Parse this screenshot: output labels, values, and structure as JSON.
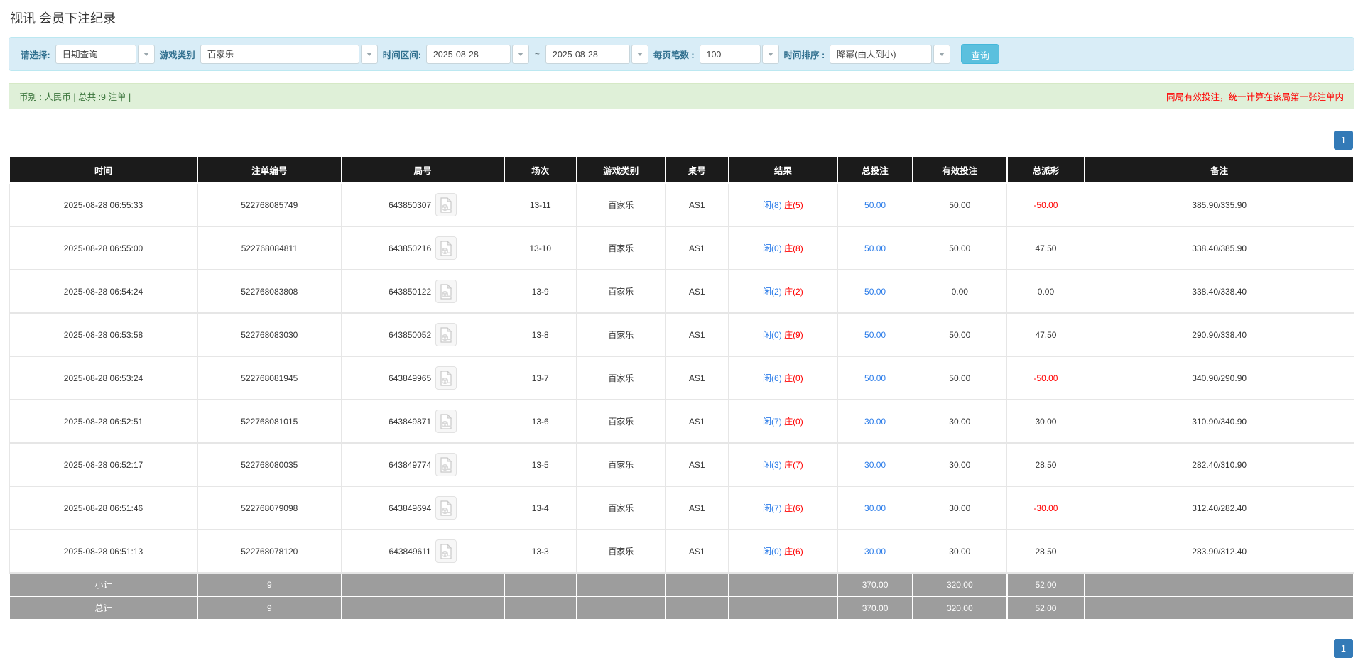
{
  "page": {
    "title": "视讯 会员下注纪录"
  },
  "filter_bar": {
    "select_label": "请选择:",
    "select_value": "日期查询",
    "game_type_label": "游戏类别",
    "game_type_value": "百家乐",
    "date_range_label": "时间区间:",
    "date_from": "2025-08-28",
    "range_separator": "~",
    "date_to": "2025-08-28",
    "page_size_label": "每页笔数 :",
    "page_size_value": "100",
    "sort_label": "时间排序 :",
    "sort_value": "降幂(由大到小)",
    "search_button": "查询"
  },
  "summary_bar": {
    "left_text": "币别 : 人民币 | 总共 :9 注单 |",
    "right_note": "同局有效投注，统一计算在该局第一张注单内"
  },
  "pagination": {
    "page": "1"
  },
  "table": {
    "headers": [
      "时间",
      "注单编号",
      "局号",
      "场次",
      "游戏类别",
      "桌号",
      "结果",
      "总投注",
      "有效投注",
      "总派彩",
      "备注"
    ],
    "rows": [
      {
        "time": "2025-08-28 06:55:33",
        "bet_id": "522768085749",
        "round_id": "643850307",
        "session": "13-11",
        "game": "百家乐",
        "table_no": "AS1",
        "result_player": "闲(8)",
        "result_banker": "庄(5)",
        "total_bet": "50.00",
        "valid_bet": "50.00",
        "payout": "-50.00",
        "note": "385.90/335.90"
      },
      {
        "time": "2025-08-28 06:55:00",
        "bet_id": "522768084811",
        "round_id": "643850216",
        "session": "13-10",
        "game": "百家乐",
        "table_no": "AS1",
        "result_player": "闲(0)",
        "result_banker": "庄(8)",
        "total_bet": "50.00",
        "valid_bet": "50.00",
        "payout": "47.50",
        "note": "338.40/385.90"
      },
      {
        "time": "2025-08-28 06:54:24",
        "bet_id": "522768083808",
        "round_id": "643850122",
        "session": "13-9",
        "game": "百家乐",
        "table_no": "AS1",
        "result_player": "闲(2)",
        "result_banker": "庄(2)",
        "total_bet": "50.00",
        "valid_bet": "0.00",
        "payout": "0.00",
        "note": "338.40/338.40"
      },
      {
        "time": "2025-08-28 06:53:58",
        "bet_id": "522768083030",
        "round_id": "643850052",
        "session": "13-8",
        "game": "百家乐",
        "table_no": "AS1",
        "result_player": "闲(0)",
        "result_banker": "庄(9)",
        "total_bet": "50.00",
        "valid_bet": "50.00",
        "payout": "47.50",
        "note": "290.90/338.40"
      },
      {
        "time": "2025-08-28 06:53:24",
        "bet_id": "522768081945",
        "round_id": "643849965",
        "session": "13-7",
        "game": "百家乐",
        "table_no": "AS1",
        "result_player": "闲(6)",
        "result_banker": "庄(0)",
        "total_bet": "50.00",
        "valid_bet": "50.00",
        "payout": "-50.00",
        "note": "340.90/290.90"
      },
      {
        "time": "2025-08-28 06:52:51",
        "bet_id": "522768081015",
        "round_id": "643849871",
        "session": "13-6",
        "game": "百家乐",
        "table_no": "AS1",
        "result_player": "闲(7)",
        "result_banker": "庄(0)",
        "total_bet": "30.00",
        "valid_bet": "30.00",
        "payout": "30.00",
        "note": "310.90/340.90"
      },
      {
        "time": "2025-08-28 06:52:17",
        "bet_id": "522768080035",
        "round_id": "643849774",
        "session": "13-5",
        "game": "百家乐",
        "table_no": "AS1",
        "result_player": "闲(3)",
        "result_banker": "庄(7)",
        "total_bet": "30.00",
        "valid_bet": "30.00",
        "payout": "28.50",
        "note": "282.40/310.90"
      },
      {
        "time": "2025-08-28 06:51:46",
        "bet_id": "522768079098",
        "round_id": "643849694",
        "session": "13-4",
        "game": "百家乐",
        "table_no": "AS1",
        "result_player": "闲(7)",
        "result_banker": "庄(6)",
        "total_bet": "30.00",
        "valid_bet": "30.00",
        "payout": "-30.00",
        "note": "312.40/282.40"
      },
      {
        "time": "2025-08-28 06:51:13",
        "bet_id": "522768078120",
        "round_id": "643849611",
        "session": "13-3",
        "game": "百家乐",
        "table_no": "AS1",
        "result_player": "闲(0)",
        "result_banker": "庄(6)",
        "total_bet": "30.00",
        "valid_bet": "30.00",
        "payout": "28.50",
        "note": "283.90/312.40"
      }
    ],
    "subtotal": {
      "label": "小计",
      "count": "9",
      "total_bet": "370.00",
      "valid_bet": "320.00",
      "payout": "52.00"
    },
    "total": {
      "label": "总计",
      "count": "9",
      "total_bet": "370.00",
      "valid_bet": "320.00",
      "payout": "52.00"
    }
  },
  "colors": {
    "header_bg": "#1b1b1b",
    "subtotal_bg": "#9d9d9d",
    "filter_bg": "#d9edf7",
    "summary_bg": "#dff0d8",
    "summary_text": "#3c763d",
    "search_button_bg": "#5bc0de",
    "pagination_bg": "#337ab7",
    "bet_blue": "#2b7ce9",
    "negative_red": "#ff0000"
  }
}
